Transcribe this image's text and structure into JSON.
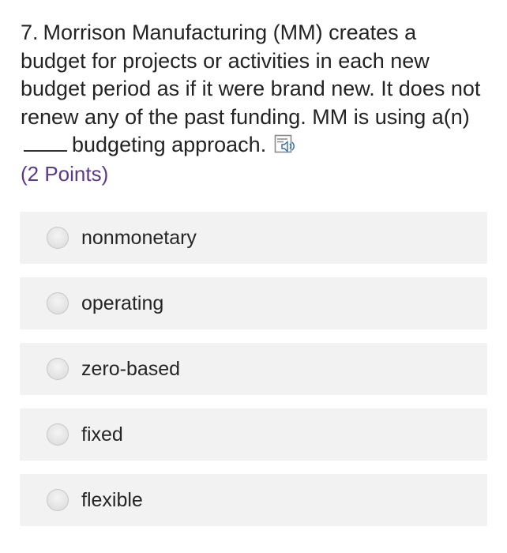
{
  "question": {
    "number": "7.",
    "text_before_blank": "Morrison Manufacturing (MM) creates a budget for projects or activities in each new budget period as if it were brand new. It does not renew any of the past funding. MM is using a(n)",
    "text_after_blank": "budgeting approach.",
    "points": "(2 Points)",
    "speaker_icon": "immersive-reader-icon"
  },
  "options": [
    {
      "label": "nonmonetary"
    },
    {
      "label": "operating"
    },
    {
      "label": "zero-based"
    },
    {
      "label": "fixed"
    },
    {
      "label": "flexible"
    }
  ],
  "colors": {
    "points_text": "#5b3a8e",
    "option_background": "#f2f2f2"
  }
}
